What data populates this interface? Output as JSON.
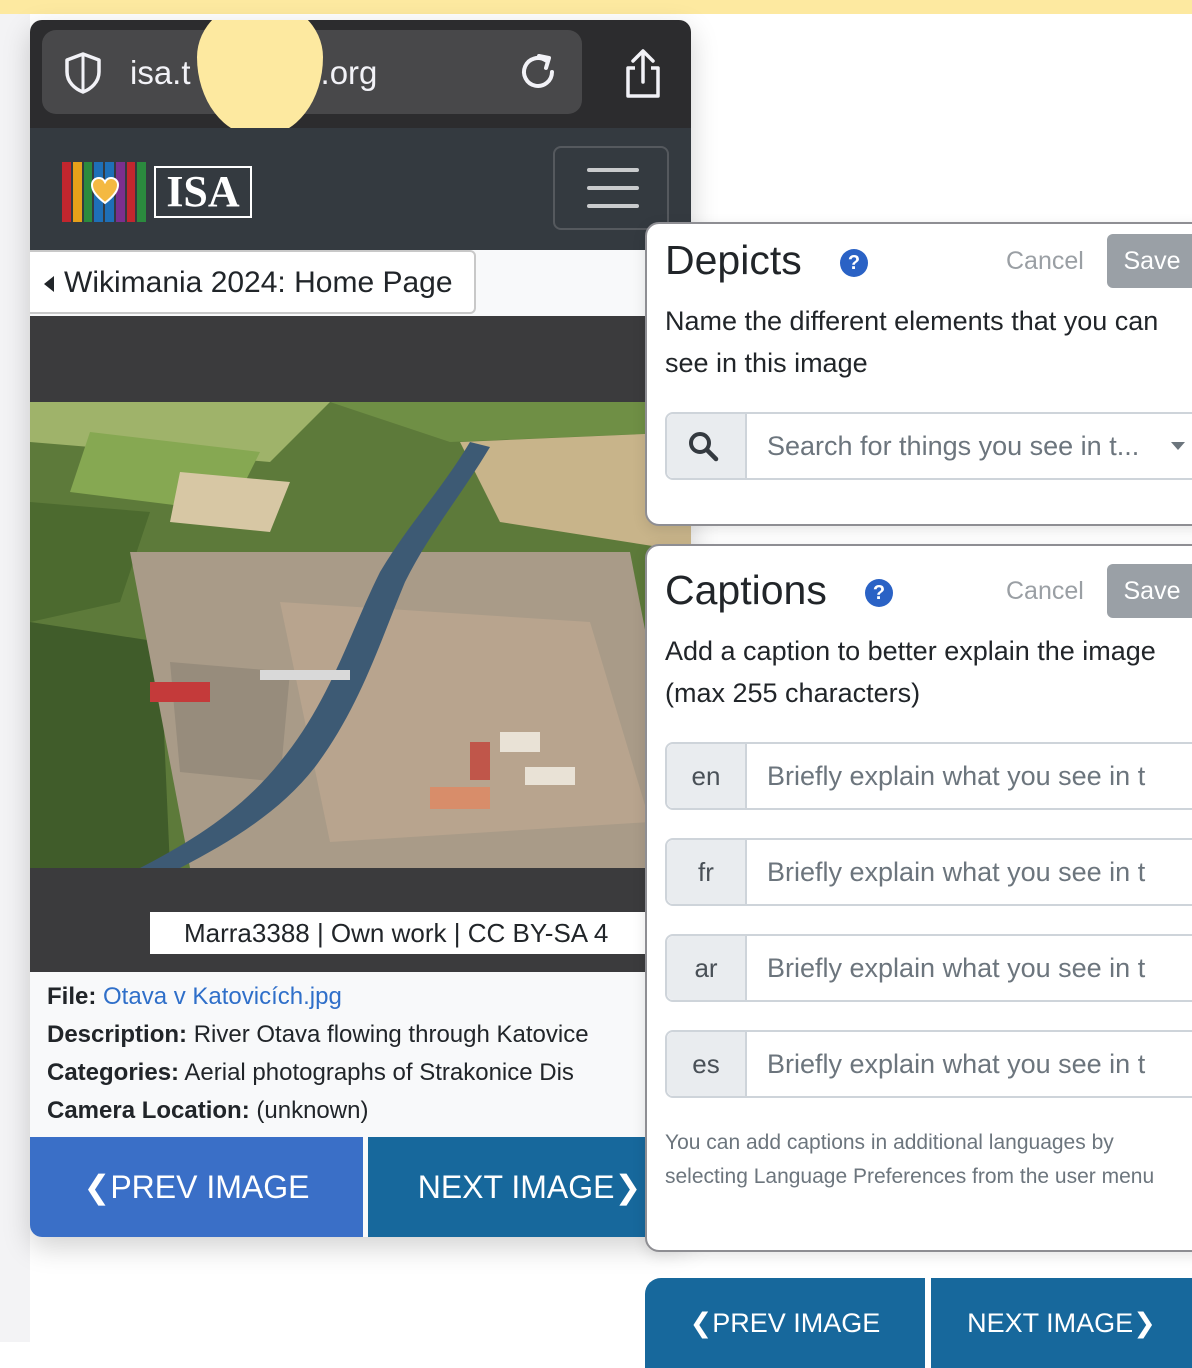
{
  "browser": {
    "url_visible_start": "isa.t",
    "url_visible_end": ".org"
  },
  "site": {
    "logo_text": "ISA",
    "breadcrumb": "Wikimania 2024: Home Page"
  },
  "image": {
    "attribution": "Marra3388 | Own work | CC BY-SA 4",
    "file_label": "File:",
    "file_name": "Otava v Katovicích.jpg",
    "description_label": "Description:",
    "description": "River Otava flowing through Katovice",
    "categories_label": "Categories:",
    "categories": "Aerial photographs of Strakonice Dis",
    "camera_label": "Camera Location:",
    "camera": "(unknown)"
  },
  "nav": {
    "prev": "❮PREV IMAGE",
    "next": "NEXT IMAGE❯"
  },
  "depicts": {
    "title": "Depicts",
    "help": "?",
    "cancel": "Cancel",
    "save": "Save",
    "description": "Name the different elements that you can see in this image",
    "search_placeholder": "Search for things you see in t..."
  },
  "captions": {
    "title": "Captions",
    "help": "?",
    "cancel": "Cancel",
    "save": "Save",
    "description": "Add a caption to better explain the image (max 255 characters)",
    "languages": [
      {
        "code": "en",
        "placeholder": "Briefly explain what you see in t"
      },
      {
        "code": "fr",
        "placeholder": "Briefly explain what you see in t"
      },
      {
        "code": "ar",
        "placeholder": "Briefly explain what you see in t"
      },
      {
        "code": "es",
        "placeholder": "Briefly explain what you see in t"
      }
    ],
    "note": "You can add captions in additional languages by selecting Language Preferences from the user menu"
  },
  "colors": {
    "highlight_yellow": "#fde9a0",
    "navbar": "#343a40",
    "primary_blue": "#3a6fc7",
    "dark_blue": "#17689c",
    "link_blue": "#2f6fc9"
  }
}
